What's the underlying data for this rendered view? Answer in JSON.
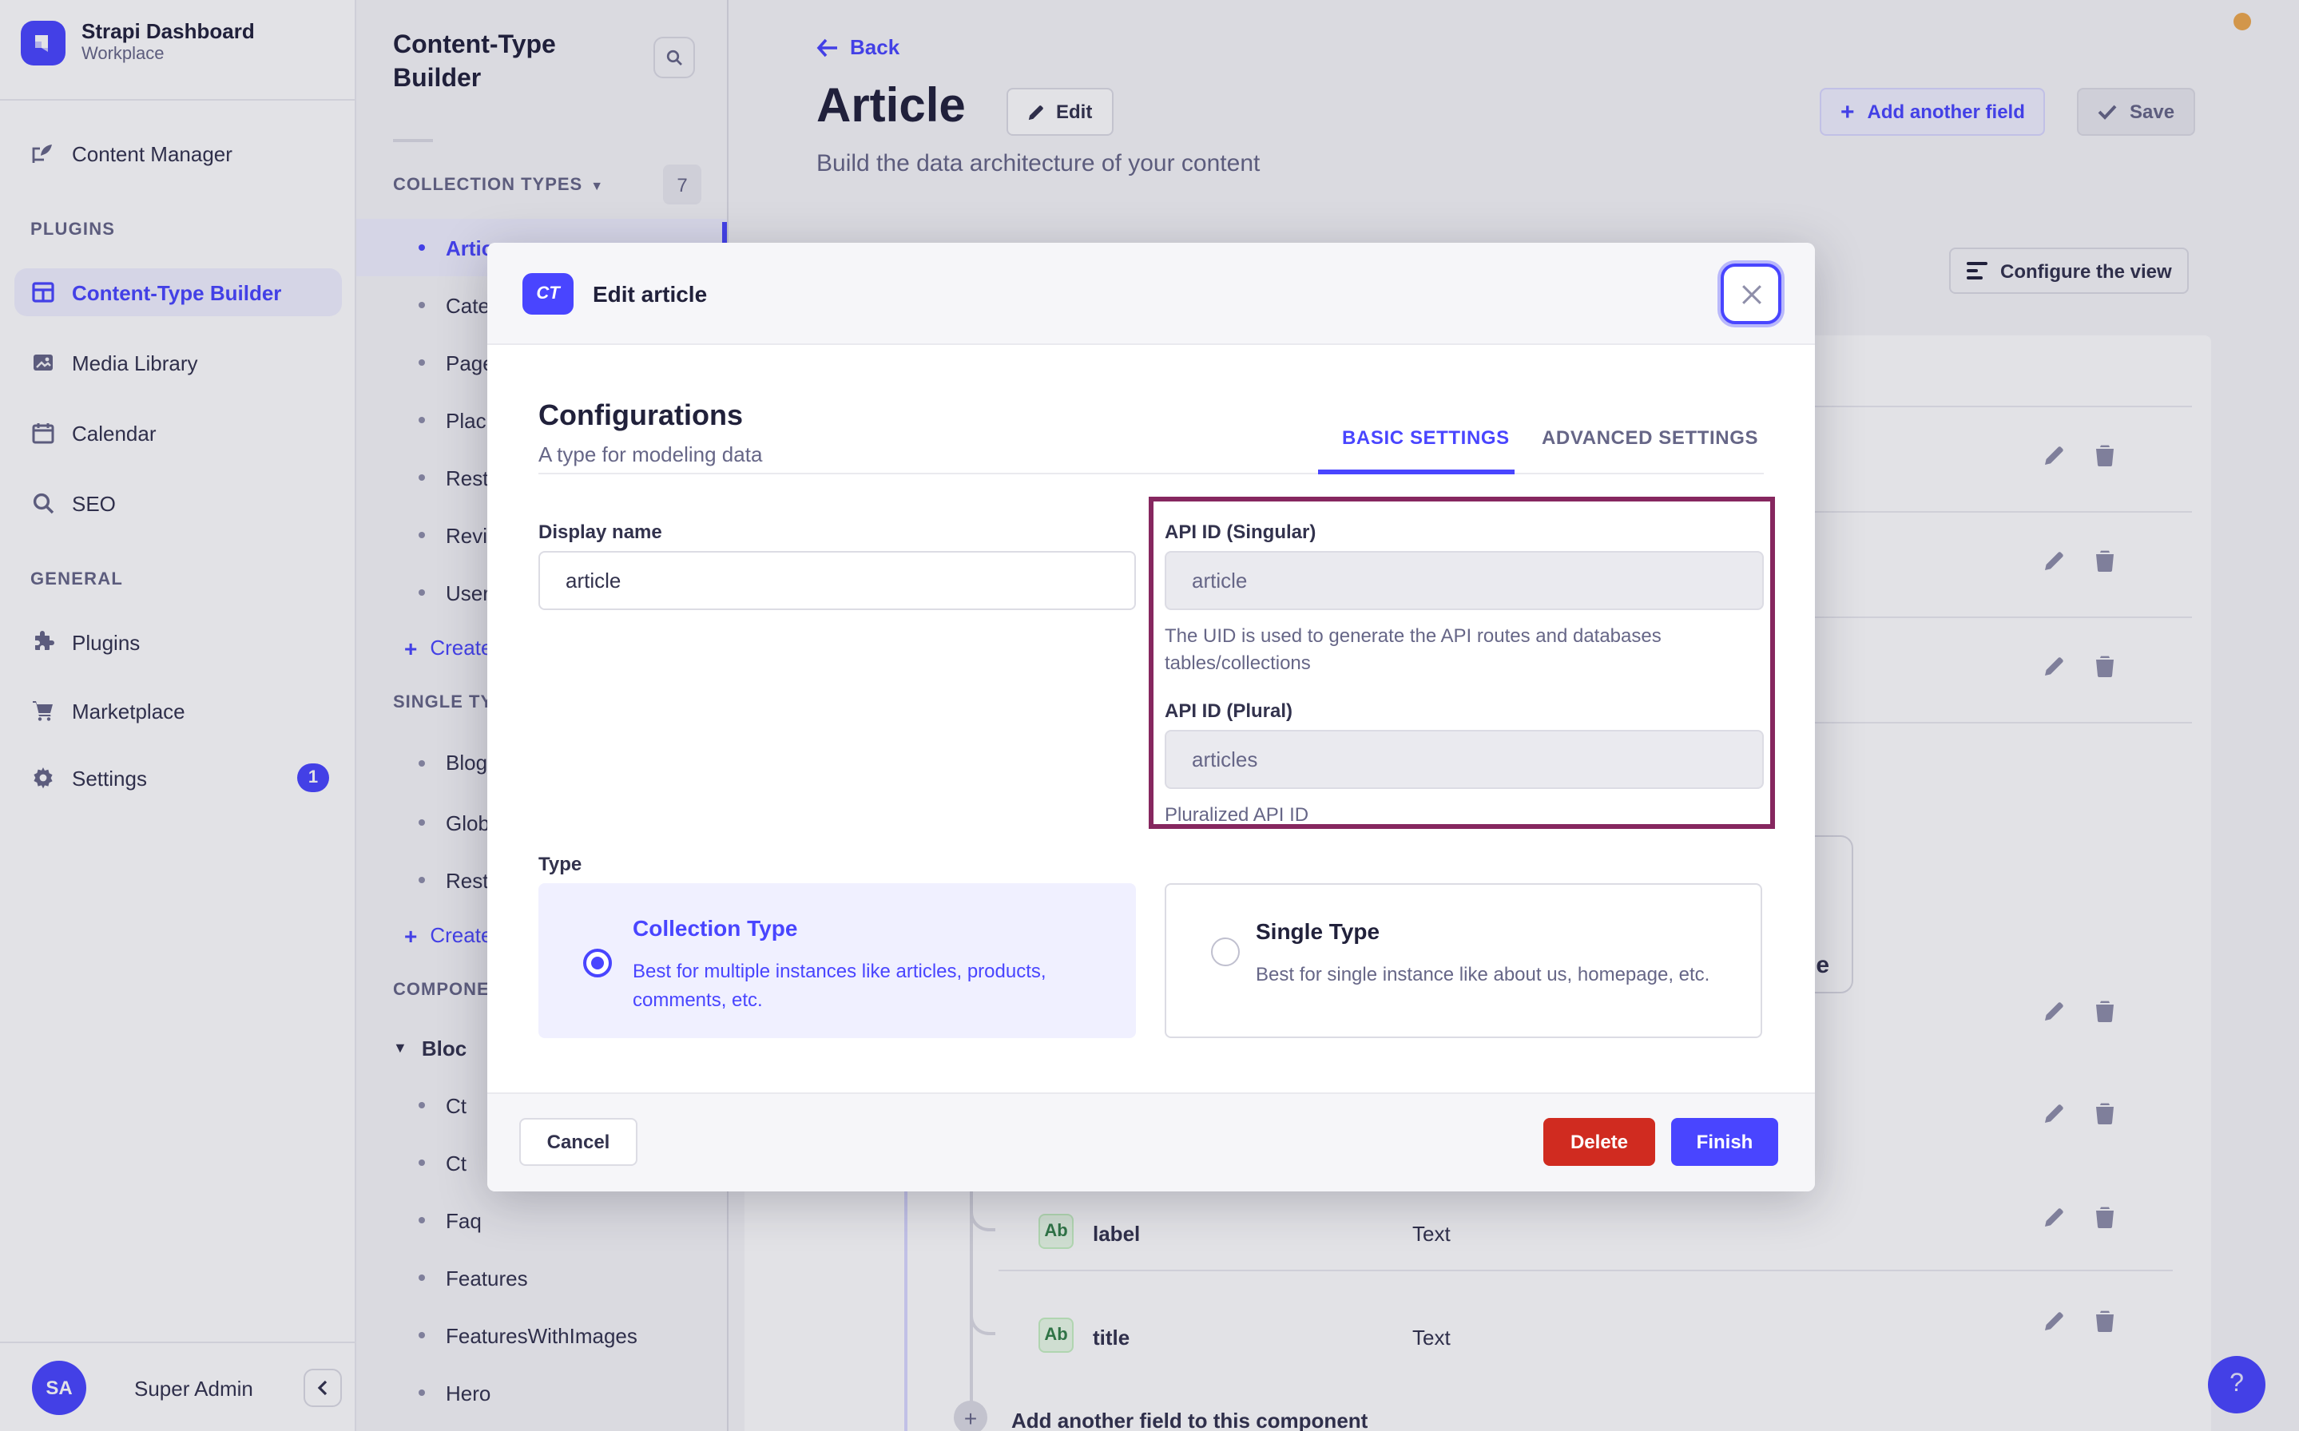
{
  "app": {
    "title": "Strapi Dashboard",
    "subtitle": "Workplace",
    "user_name": "Super Admin",
    "user_initials": "SA",
    "help_label": "?"
  },
  "left_nav": {
    "content_manager": "Content Manager",
    "plugins_header": "PLUGINS",
    "content_type_builder": "Content-Type Builder",
    "media_library": "Media Library",
    "calendar": "Calendar",
    "seo": "SEO",
    "general_header": "GENERAL",
    "plugins": "Plugins",
    "marketplace": "Marketplace",
    "settings": "Settings",
    "settings_badge": "1"
  },
  "ctb_nav": {
    "title": "Content-Type Builder",
    "collection_header": "COLLECTION TYPES",
    "collection_count": "7",
    "items": {
      "i0": "Artic",
      "i1": "Cate",
      "i2": "Page",
      "i3": "Plac",
      "i4": "Rest",
      "i5": "Revi",
      "i6": "User"
    },
    "collection_create": "Create",
    "single_header": "SINGLE TY",
    "single": {
      "i0": "Blog",
      "i1": "Glob",
      "i2": "Rest"
    },
    "single_create": "Create",
    "components_header": "COMPONE",
    "component_group": "Bloc",
    "components": {
      "i0": "Ct",
      "i1": "Ct",
      "i2": "Faq",
      "i3": "Features",
      "i4": "FeaturesWithImages",
      "i5": "Hero"
    }
  },
  "header": {
    "back": "Back",
    "title": "Article",
    "edit": "Edit",
    "subtitle": "Build the data architecture of your content",
    "add_field": "Add another field",
    "save": "Save"
  },
  "content": {
    "configure_view": "Configure the view",
    "peek_text": "e",
    "fields": {
      "f0": {
        "badge": "Ab",
        "name": "label",
        "type": "Text"
      },
      "f1": {
        "badge": "Ab",
        "name": "title",
        "type": "Text"
      }
    },
    "add_field_row": "Add another field to this component"
  },
  "modal": {
    "badge": "CT",
    "title": "Edit article",
    "heading": "Configurations",
    "subheading": "A type for modeling data",
    "tab_basic": "BASIC SETTINGS",
    "tab_advanced": "ADVANCED SETTINGS",
    "display_name": {
      "label": "Display name",
      "value": "article"
    },
    "api_singular": {
      "label": "API ID (Singular)",
      "value": "article",
      "help_line1": "The UID is used to generate the API routes and databases",
      "help_line2": "tables/collections"
    },
    "api_plural": {
      "label": "API ID (Plural)",
      "value": "articles",
      "help": "Pluralized API ID"
    },
    "type_label": "Type",
    "collection_type": {
      "title": "Collection Type",
      "desc_line1": "Best for multiple instances like articles, products,",
      "desc_line2": "comments, etc."
    },
    "single_type": {
      "title": "Single Type",
      "desc": "Best for single instance like about us, homepage, etc."
    },
    "cancel": "Cancel",
    "delete": "Delete",
    "finish": "Finish"
  },
  "colors": {
    "accent": "#4945ff",
    "danger": "#d02b20",
    "annotation": "#86275f",
    "notification_dot": "#eda84c",
    "field_badge_green": "#328048"
  }
}
